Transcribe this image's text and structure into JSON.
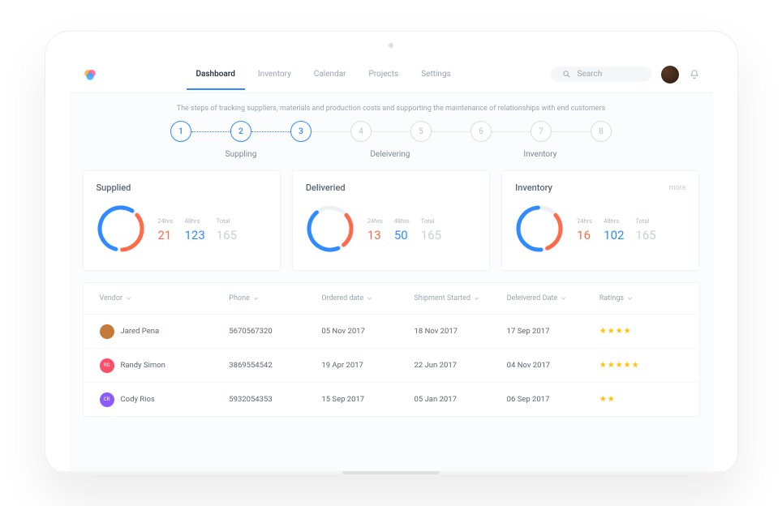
{
  "nav": {
    "items": [
      "Dashboard",
      "Inventory",
      "Calendar",
      "Projects",
      "Settings"
    ],
    "active_index": 0
  },
  "search": {
    "placeholder": "Search"
  },
  "subtitle": "The steps of tracking suppliers, materials and production costs and supporting the maintenance of relationships with end customers",
  "stepper": {
    "steps": [
      "1",
      "2",
      "3",
      "4",
      "5",
      "6",
      "7",
      "8"
    ],
    "completed": 3,
    "labels": [
      "Suppling",
      "Deleivering",
      "Inventory"
    ]
  },
  "cards": [
    {
      "title": "Supplied",
      "more": "",
      "metrics": {
        "h24_label": "24hrs",
        "h24": "21",
        "h48_label": "48hrs",
        "h48": "123",
        "total_label": "Total",
        "total": "165"
      },
      "donut": {
        "orange_pct": 35,
        "blue_pct": 55,
        "gap": 10
      }
    },
    {
      "title": "Deliveried",
      "more": "",
      "metrics": {
        "h24_label": "24hrs",
        "h24": "13",
        "h48_label": "48hrs",
        "h48": "50",
        "total_label": "Total",
        "total": "165"
      },
      "donut": {
        "orange_pct": 25,
        "blue_pct": 45,
        "gap": 30
      }
    },
    {
      "title": "Inventory",
      "more": "more",
      "metrics": {
        "h24_label": "24hrs",
        "h24": "16",
        "h48_label": "48hrs",
        "h48": "102",
        "total_label": "Total",
        "total": "165"
      },
      "donut": {
        "orange_pct": 30,
        "blue_pct": 50,
        "gap": 20
      }
    }
  ],
  "table": {
    "headers": [
      "Vendor",
      "Phone",
      "Ordered date",
      "Shipment Started",
      "Deleivered Date",
      "Ratings"
    ],
    "rows": [
      {
        "vendor": "Jared Pena",
        "avatar_color": "#c47a3a",
        "avatar_initials": "",
        "phone": "5670567320",
        "ordered": "05 Nov 2017",
        "shipped": "18 Nov 2017",
        "delivered": "17 Sep 2017",
        "rating": 4
      },
      {
        "vendor": "Randy Simon",
        "avatar_color": "#ff4d6a",
        "avatar_initials": "RS",
        "phone": "3869554542",
        "ordered": "19 Apr 2017",
        "shipped": "22 Jun 2017",
        "delivered": "04 Nov 2017",
        "rating": 5
      },
      {
        "vendor": "Cody Rios",
        "avatar_color": "#8a5cff",
        "avatar_initials": "CR",
        "phone": "5932054353",
        "ordered": "15 Sep 2017",
        "shipped": "05 Jan 2017",
        "delivered": "06 Sep 2017",
        "rating": 2
      }
    ]
  }
}
